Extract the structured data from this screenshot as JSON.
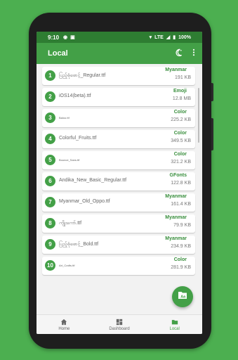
{
  "status": {
    "time": "9:10",
    "network": "LTE",
    "battery": "100%"
  },
  "appbar": {
    "title": "Local"
  },
  "fonts": [
    {
      "number": "1",
      "name": "ပြည့်စုံဖောင့်_Regular.ttf",
      "category": "Myanmar",
      "size": "191 KB"
    },
    {
      "number": "2",
      "name": "iOS14(beta).ttf",
      "category": "Emoji",
      "size": "12.8 MB"
    },
    {
      "number": "3",
      "name": "Baloo.ttf",
      "category": "Color",
      "size": "225.2 KB"
    },
    {
      "number": "4",
      "name": "Colorful_Fruits.ttf",
      "category": "Color",
      "size": "349.5 KB"
    },
    {
      "number": "5",
      "name": "Bounce_Sans.ttf",
      "category": "Color",
      "size": "321.2 KB"
    },
    {
      "number": "6",
      "name": "Andika_New_Basic_Regular.ttf",
      "category": "GFonts",
      "size": "122.8 KB"
    },
    {
      "number": "7",
      "name": "Myanmar_Old_Oppo.ttf",
      "category": "Myanmar",
      "size": "161.4 KB"
    },
    {
      "number": "8",
      "name": "ကျိုးကော်.ttf",
      "category": "Myanmar",
      "size": "79.9 KB"
    },
    {
      "number": "9",
      "name": "ပြည့်စုံဖောင့်_Bold.ttf",
      "category": "Myanmar",
      "size": "234.9 KB"
    },
    {
      "number": "10",
      "name": "Art_Crafts.ttf",
      "category": "Color",
      "size": "281.9 KB"
    }
  ],
  "nav": {
    "home": "Home",
    "dashboard": "Dashboard",
    "local": "Local"
  },
  "colors": {
    "background": "#4caf50",
    "appbar": "#43a047",
    "statusbar": "#2e7d32",
    "accent": "#388e3c"
  }
}
